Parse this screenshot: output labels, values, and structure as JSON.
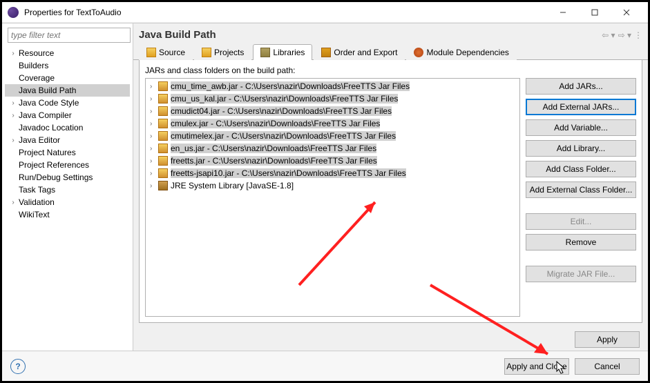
{
  "window": {
    "title": "Properties for TextToAudio"
  },
  "filter": {
    "placeholder": "type filter text"
  },
  "nav_tree": [
    {
      "label": "Resource",
      "expandable": true
    },
    {
      "label": "Builders",
      "expandable": false
    },
    {
      "label": "Coverage",
      "expandable": false
    },
    {
      "label": "Java Build Path",
      "expandable": false,
      "selected": true
    },
    {
      "label": "Java Code Style",
      "expandable": true
    },
    {
      "label": "Java Compiler",
      "expandable": true
    },
    {
      "label": "Javadoc Location",
      "expandable": false
    },
    {
      "label": "Java Editor",
      "expandable": true
    },
    {
      "label": "Project Natures",
      "expandable": false
    },
    {
      "label": "Project References",
      "expandable": false
    },
    {
      "label": "Run/Debug Settings",
      "expandable": false
    },
    {
      "label": "Task Tags",
      "expandable": false
    },
    {
      "label": "Validation",
      "expandable": true
    },
    {
      "label": "WikiText",
      "expandable": false
    }
  ],
  "page": {
    "title": "Java Build Path"
  },
  "tabs": [
    {
      "label": "Source",
      "icon": "source-icon"
    },
    {
      "label": "Projects",
      "icon": "projects-icon"
    },
    {
      "label": "Libraries",
      "icon": "libraries-icon",
      "active": true
    },
    {
      "label": "Order and Export",
      "icon": "order-icon"
    },
    {
      "label": "Module Dependencies",
      "icon": "module-icon"
    }
  ],
  "list_label": "JARs and class folders on the build path:",
  "jars": [
    {
      "label": "cmu_time_awb.jar - C:\\Users\\nazir\\Downloads\\FreeTTS Jar Files",
      "kind": "jar",
      "hl": true
    },
    {
      "label": "cmu_us_kal.jar - C:\\Users\\nazir\\Downloads\\FreeTTS Jar Files",
      "kind": "jar",
      "hl": true
    },
    {
      "label": "cmudict04.jar - C:\\Users\\nazir\\Downloads\\FreeTTS Jar Files",
      "kind": "jar",
      "hl": true
    },
    {
      "label": "cmulex.jar - C:\\Users\\nazir\\Downloads\\FreeTTS Jar Files",
      "kind": "jar",
      "hl": true
    },
    {
      "label": "cmutimelex.jar - C:\\Users\\nazir\\Downloads\\FreeTTS Jar Files",
      "kind": "jar",
      "hl": true
    },
    {
      "label": "en_us.jar - C:\\Users\\nazir\\Downloads\\FreeTTS Jar Files",
      "kind": "jar",
      "hl": true
    },
    {
      "label": "freetts.jar - C:\\Users\\nazir\\Downloads\\FreeTTS Jar Files",
      "kind": "jar",
      "hl": true
    },
    {
      "label": "freetts-jsapi10.jar - C:\\Users\\nazir\\Downloads\\FreeTTS Jar Files",
      "kind": "jar",
      "hl": true
    },
    {
      "label": "JRE System Library [JavaSE-1.8]",
      "kind": "jre",
      "hl": false
    }
  ],
  "side_buttons": {
    "add_jars": "Add JARs...",
    "add_external_jars": "Add External JARs...",
    "add_variable": "Add Variable...",
    "add_library": "Add Library...",
    "add_class_folder": "Add Class Folder...",
    "add_external_class_folder": "Add External Class Folder...",
    "edit": "Edit...",
    "remove": "Remove",
    "migrate": "Migrate JAR File..."
  },
  "footer": {
    "apply": "Apply",
    "apply_close": "Apply and Close",
    "cancel": "Cancel"
  }
}
